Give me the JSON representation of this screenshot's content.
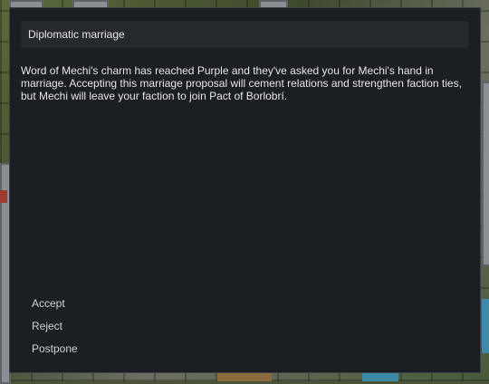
{
  "dialog": {
    "title": "Diplomatic marriage",
    "body": "Word of Mechi's charm has reached Purple and they've asked you for Mechi's hand in marriage. Accepting this marriage proposal will cement relations and strengthen faction ties, but Mechi will leave your faction to join Pact of Borlobrí.",
    "options": [
      "Accept",
      "Reject",
      "Postpone"
    ]
  },
  "colors": {
    "dialog_bg": "#1b1e22",
    "titlebar_bg": "#25282d",
    "text": "#e6e6e6"
  }
}
